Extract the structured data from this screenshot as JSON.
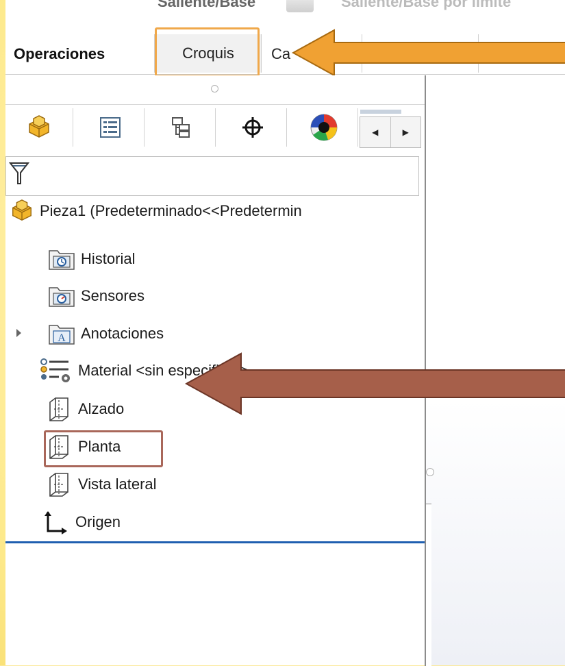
{
  "toolbar_cut": {
    "left_text": "Saliente/Base",
    "right_text": "Saliente/Base por límite"
  },
  "command_tabs": [
    {
      "label": "Operaciones",
      "active": true
    },
    {
      "label": "Croquis",
      "active": false,
      "highlighted": true
    },
    {
      "label": "Ca",
      "active": false
    }
  ],
  "manager_tabs": [
    {
      "name": "featuremanager",
      "icon": "part-icon"
    },
    {
      "name": "propertymanager",
      "icon": "property-list-icon"
    },
    {
      "name": "configurationmanager",
      "icon": "configuration-icon"
    },
    {
      "name": "dimxpertmanager",
      "icon": "crosshair-icon"
    },
    {
      "name": "displaymanager",
      "icon": "appearance-sphere-icon"
    }
  ],
  "tree": {
    "root": "Pieza1  (Predeterminado<<Predetermin",
    "items": [
      {
        "label": "Historial",
        "icon": "history-folder-icon"
      },
      {
        "label": "Sensores",
        "icon": "sensor-folder-icon"
      },
      {
        "label": "Anotaciones",
        "icon": "annotations-folder-icon",
        "expandable": true
      },
      {
        "label": "Material <sin especificar>",
        "icon": "material-icon"
      },
      {
        "label": "Alzado",
        "icon": "plane-icon"
      },
      {
        "label": "Planta",
        "icon": "plane-icon",
        "highlighted": true
      },
      {
        "label": "Vista lateral",
        "icon": "plane-icon"
      },
      {
        "label": "Origen",
        "icon": "origin-icon"
      }
    ]
  },
  "colors": {
    "frame": "#fde98a",
    "orange_arrow": "#f0a133",
    "brown_arrow": "#a65f4a",
    "croquis_box": "#f0a84a",
    "planta_box": "#a9675a",
    "tree_separator": "#1f5fb0"
  }
}
